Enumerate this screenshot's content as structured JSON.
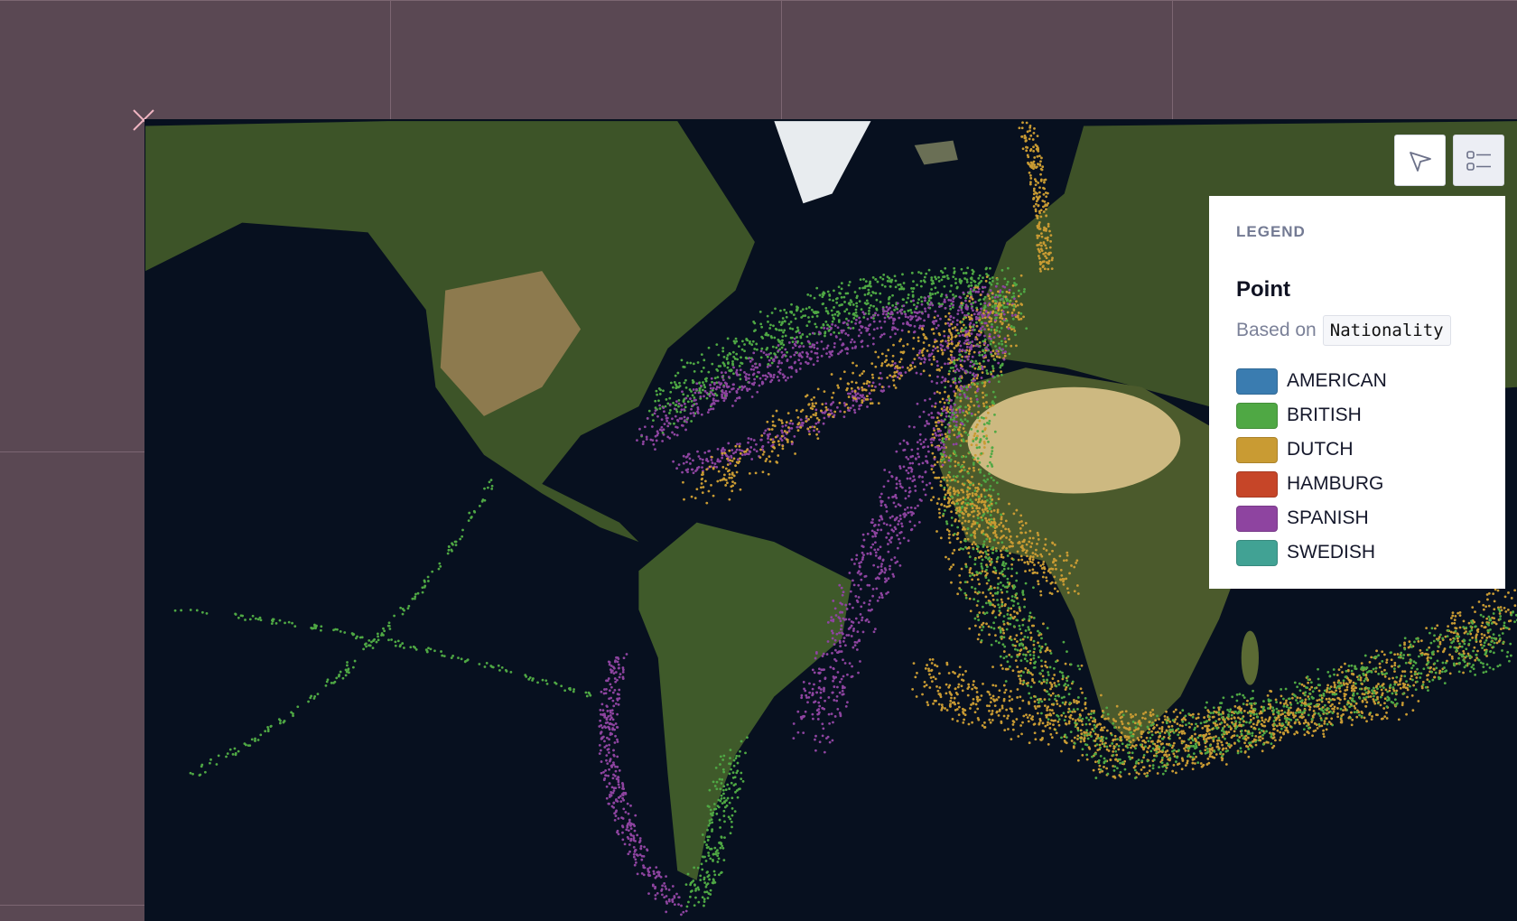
{
  "map": {
    "basemap": "satellite",
    "background_color": "#07101f"
  },
  "toolbar": {
    "pointer_icon": "cursor-arrow-icon",
    "legend_toggle_icon": "legend-list-icon"
  },
  "legend": {
    "title": "LEGEND",
    "layer_name": "Point",
    "based_on_label": "Based on",
    "based_on_field": "Nationality",
    "items": [
      {
        "label": "AMERICAN",
        "color": "#3a7cb0"
      },
      {
        "label": "BRITISH",
        "color": "#4fa844"
      },
      {
        "label": "DUTCH",
        "color": "#c99b33"
      },
      {
        "label": "HAMBURG",
        "color": "#c64528"
      },
      {
        "label": "SPANISH",
        "color": "#8e44a0"
      },
      {
        "label": "SWEDISH",
        "color": "#41a294"
      }
    ]
  }
}
